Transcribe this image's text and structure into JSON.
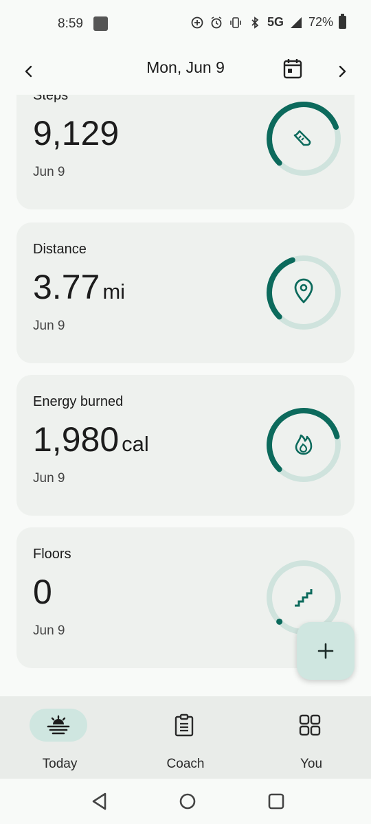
{
  "status_bar": {
    "time": "8:59",
    "network": "5G",
    "battery": "72%"
  },
  "header": {
    "title": "Mon, Jun 9",
    "prev_icon": "chevron-left-icon",
    "next_icon": "chevron-right-icon",
    "calendar_icon": "calendar-icon"
  },
  "cards": [
    {
      "label": "Steps",
      "value": "9,129",
      "unit": "",
      "date": "Jun 9",
      "icon": "shoe-icon",
      "progress": 0.76
    },
    {
      "label": "Distance",
      "value": "3.77",
      "unit": "mi",
      "date": "Jun 9",
      "icon": "location-pin-icon",
      "progress": 0.43
    },
    {
      "label": "Energy burned",
      "value": "1,980",
      "unit": "cal",
      "date": "Jun 9",
      "icon": "flame-icon",
      "progress": 0.78
    },
    {
      "label": "Floors",
      "value": "0",
      "unit": "",
      "date": "Jun 9",
      "icon": "stairs-icon",
      "progress": 0
    }
  ],
  "fab": {
    "icon": "plus-icon"
  },
  "bottom_nav": {
    "items": [
      {
        "label": "Today",
        "icon": "sunrise-icon",
        "active": true
      },
      {
        "label": "Coach",
        "icon": "clipboard-icon",
        "active": false
      },
      {
        "label": "You",
        "icon": "grid-icon",
        "active": false
      }
    ]
  },
  "colors": {
    "accent": "#0c6a5c",
    "track": "#cfe3dd",
    "card_bg": "#eef1ee",
    "pill": "#cfe6e0"
  }
}
